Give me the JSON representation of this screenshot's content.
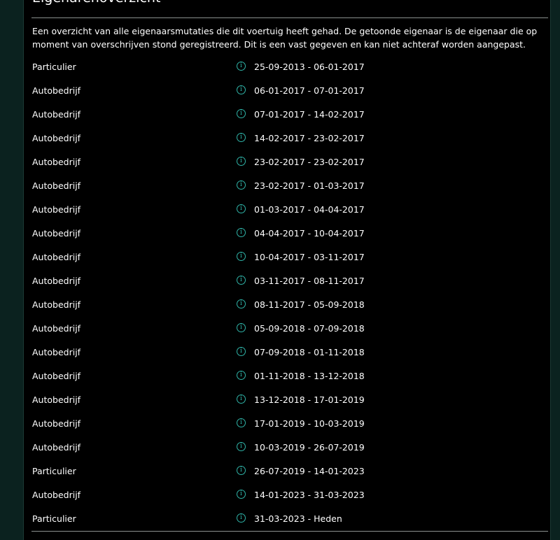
{
  "section": {
    "title": "Eigenarenoverzicht",
    "intro": "Een overzicht van alle eigenaarsmutaties die dit voertuig heeft gehad. De getoonde eigenaar is de eigenaar die op moment van overschrijven stond geregistreerd. Dit is een vast gegeven en kan niet achteraf worden aangepast."
  },
  "icons": {
    "info": "info-icon",
    "info_glyph": "i",
    "accent_color": "#2fb3a7"
  },
  "owners": [
    {
      "type": "Particulier",
      "period": "25-09-2013 - 06-01-2017"
    },
    {
      "type": "Autobedrijf",
      "period": "06-01-2017 - 07-01-2017"
    },
    {
      "type": "Autobedrijf",
      "period": "07-01-2017 - 14-02-2017"
    },
    {
      "type": "Autobedrijf",
      "period": "14-02-2017 - 23-02-2017"
    },
    {
      "type": "Autobedrijf",
      "period": "23-02-2017 - 23-02-2017"
    },
    {
      "type": "Autobedrijf",
      "period": "23-02-2017 - 01-03-2017"
    },
    {
      "type": "Autobedrijf",
      "period": "01-03-2017 - 04-04-2017"
    },
    {
      "type": "Autobedrijf",
      "period": "04-04-2017 - 10-04-2017"
    },
    {
      "type": "Autobedrijf",
      "period": "10-04-2017 - 03-11-2017"
    },
    {
      "type": "Autobedrijf",
      "period": "03-11-2017 - 08-11-2017"
    },
    {
      "type": "Autobedrijf",
      "period": "08-11-2017 - 05-09-2018"
    },
    {
      "type": "Autobedrijf",
      "period": "05-09-2018 - 07-09-2018"
    },
    {
      "type": "Autobedrijf",
      "period": "07-09-2018 - 01-11-2018"
    },
    {
      "type": "Autobedrijf",
      "period": "01-11-2018 - 13-12-2018"
    },
    {
      "type": "Autobedrijf",
      "period": "13-12-2018 - 17-01-2019"
    },
    {
      "type": "Autobedrijf",
      "period": "17-01-2019 - 10-03-2019"
    },
    {
      "type": "Autobedrijf",
      "period": "10-03-2019 - 26-07-2019"
    },
    {
      "type": "Particulier",
      "period": "26-07-2019 - 14-01-2023"
    },
    {
      "type": "Autobedrijf",
      "period": "14-01-2023 - 31-03-2023"
    },
    {
      "type": "Particulier",
      "period": "31-03-2023 - Heden"
    }
  ]
}
